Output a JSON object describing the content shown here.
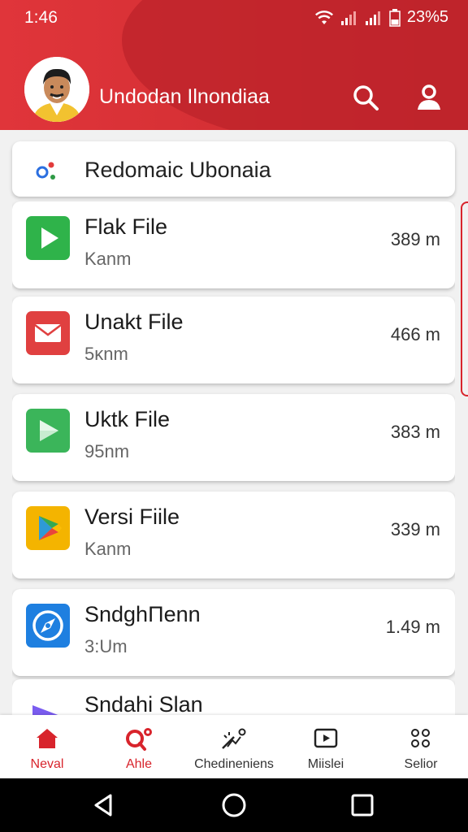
{
  "status_bar": {
    "time": "1:46",
    "battery": "23%5"
  },
  "header": {
    "title": "Undodan Ilnondiaa"
  },
  "search": {
    "text": "Redomaic Ubonaia"
  },
  "files": [
    {
      "name": "Flak File",
      "sub": "Kanm",
      "size": "389 m",
      "icon": "play-icon",
      "color": "#2fb34a"
    },
    {
      "name": "Unakt File",
      "sub": "5κnm",
      "size": "466 m",
      "icon": "mail-icon",
      "color": "#e04040"
    },
    {
      "name": "Uktk File",
      "sub": "95nm",
      "size": "383 m",
      "icon": "play-icon",
      "color": "#3bb55a"
    },
    {
      "name": "Versi Fiile",
      "sub": "Kanm",
      "size": "339 m",
      "icon": "play-store-icon",
      "color": "#f4b400"
    },
    {
      "name": "SndghΠenn",
      "sub": "3:Um",
      "size": "1.49 m",
      "icon": "compass-icon",
      "color": "#1e7fe0"
    },
    {
      "name": "Sndahi Slan",
      "sub": "",
      "size": "",
      "icon": "play-icon",
      "color": "#7a5cf0"
    }
  ],
  "bottom_nav": [
    {
      "label": "Neval",
      "icon": "home-icon",
      "active": true
    },
    {
      "label": "Ahle",
      "icon": "search-badge-icon",
      "active": true
    },
    {
      "label": "Chedineniens",
      "icon": "wand-icon",
      "active": false
    },
    {
      "label": "Miislei",
      "icon": "video-icon",
      "active": false
    },
    {
      "label": "Selior",
      "icon": "apps-icon",
      "active": false
    }
  ],
  "colors": {
    "accent": "#d8242c",
    "header": "#d63035"
  }
}
